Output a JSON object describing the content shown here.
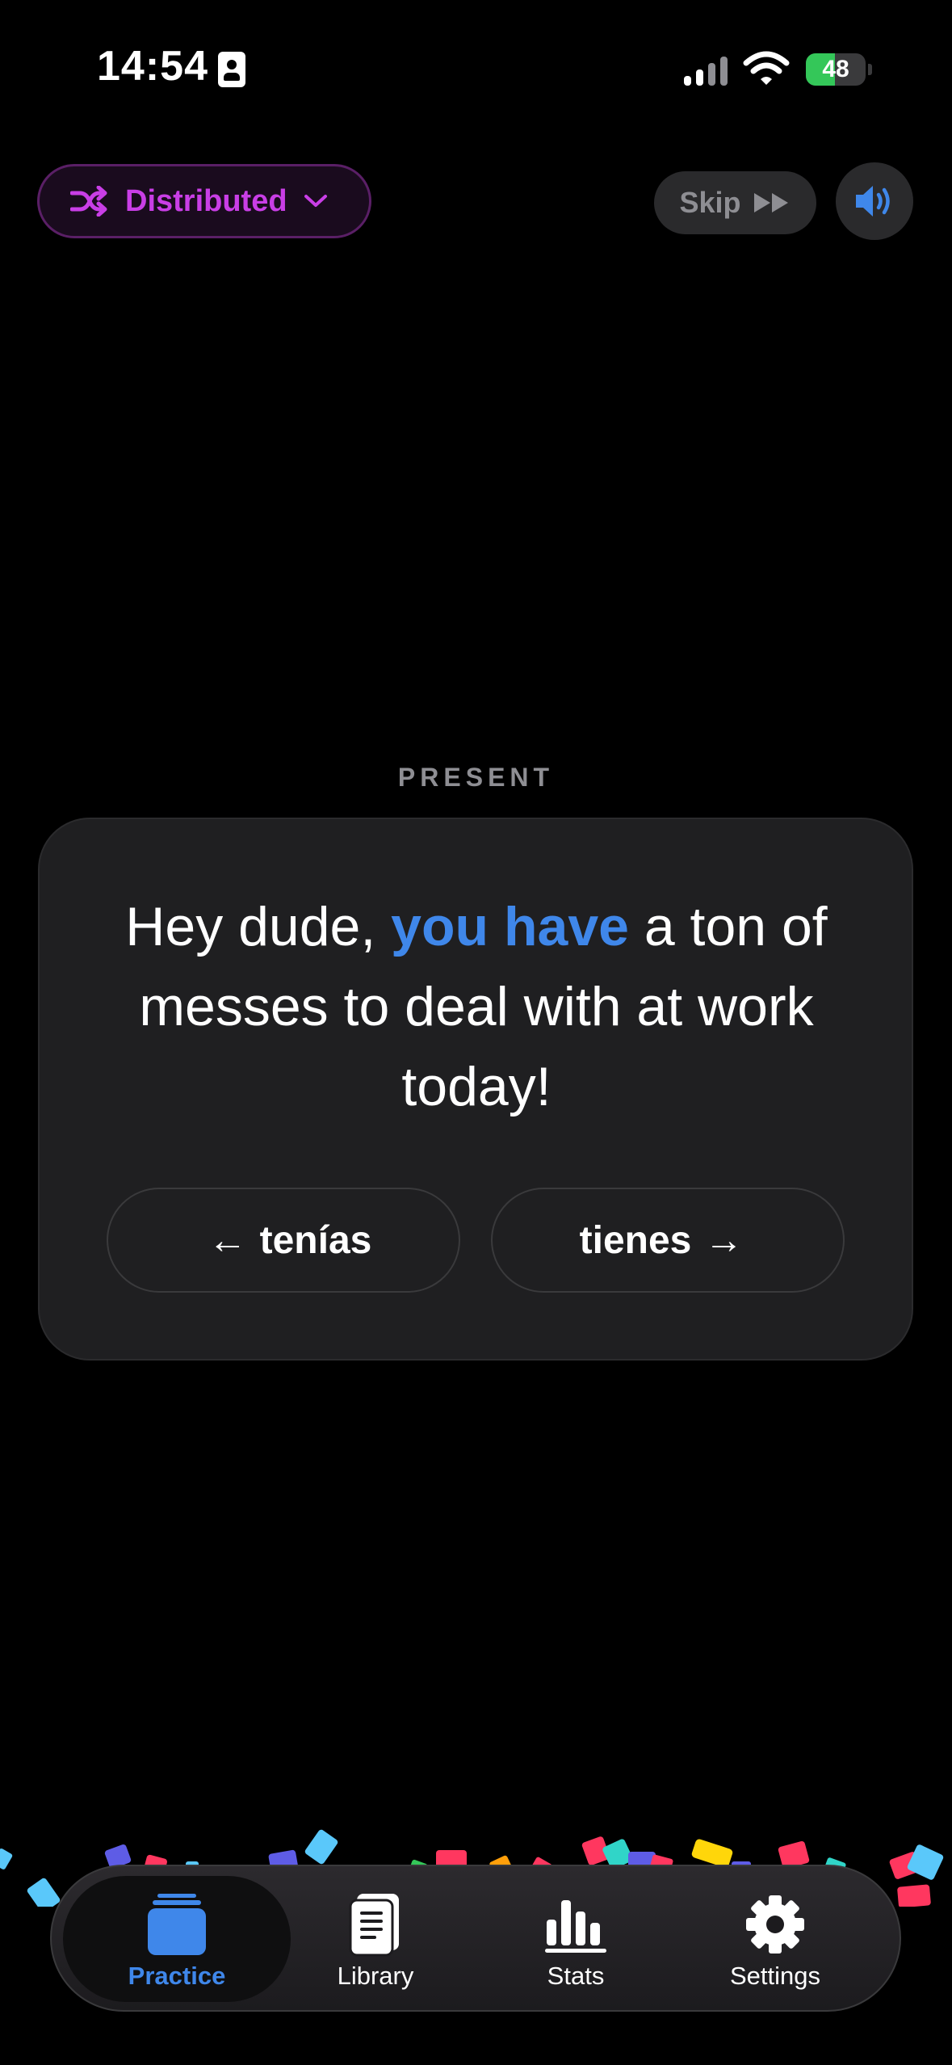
{
  "status_bar": {
    "time": "14:54",
    "battery_percent": "48",
    "battery_level": 0.48,
    "icons": [
      "id-card-icon",
      "cellular-signal-icon",
      "wifi-icon",
      "battery-charging-icon"
    ]
  },
  "top_controls": {
    "mode_label": "Distributed",
    "mode_icon": "shuffle-icon",
    "skip_label": "Skip",
    "sound_icon": "speaker-icon",
    "accent_color": "#c93ee6"
  },
  "card": {
    "tense_label": "PRESENT",
    "sentence_before": "Hey dude, ",
    "sentence_highlight": "you have",
    "sentence_after": " a ton of messes to deal with at work today!",
    "highlight_color": "#3f87ea",
    "left_choice": "tenías",
    "right_choice": "tienes"
  },
  "tabs": [
    {
      "label": "Practice",
      "icon": "practice-cards-icon",
      "active": true
    },
    {
      "label": "Library",
      "icon": "library-book-icon",
      "active": false
    },
    {
      "label": "Stats",
      "icon": "stats-bars-icon",
      "active": false
    },
    {
      "label": "Settings",
      "icon": "gear-icon",
      "active": false
    }
  ]
}
